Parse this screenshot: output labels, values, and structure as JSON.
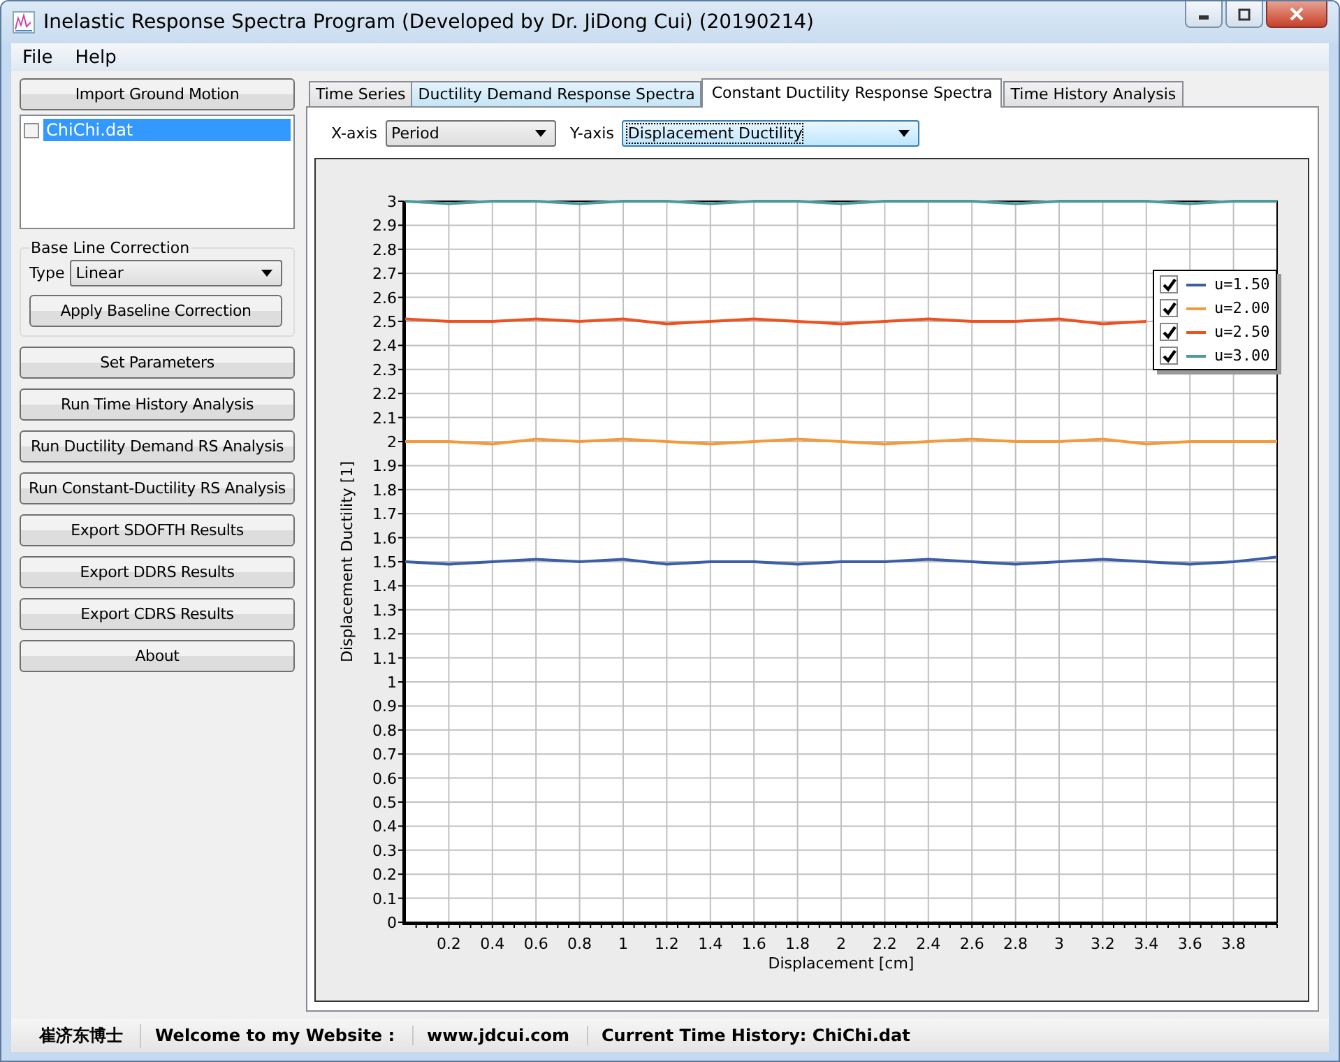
{
  "window": {
    "title": "Inelastic Response Spectra Program (Developed by Dr. JiDong Cui) (20190214)"
  },
  "menu": [
    "File",
    "Help"
  ],
  "sidebar": {
    "import_button": "Import Ground Motion",
    "files": [
      {
        "label": "ChiChi.dat",
        "checked": false,
        "selected": true
      }
    ],
    "baseline": {
      "title": "Base Line Correction",
      "type_label": "Type",
      "type_value": "Linear",
      "apply_button": "Apply Baseline Correction"
    },
    "buttons": [
      "Set Parameters",
      "Run Time History Analysis",
      "Run Ductility Demand RS Analysis",
      "Run Constant-Ductility RS Analysis",
      "Export SDOFTH Results",
      "Export DDRS Results",
      "Export CDRS Results",
      "About"
    ]
  },
  "tabs": [
    {
      "label": "Time Series",
      "selected": false
    },
    {
      "label": "Ductility Demand Response Spectra",
      "selected": false
    },
    {
      "label": "Constant Ductility Response Spectra",
      "selected": true
    },
    {
      "label": "Time History Analysis",
      "selected": false
    }
  ],
  "axis_selectors": [
    {
      "label": "X-axis",
      "value": "Period",
      "focused": false
    },
    {
      "label": "Y-axis",
      "value": "Displacement Ductility",
      "focused": true
    }
  ],
  "chart": {
    "legend": [
      {
        "checked": true
      },
      {
        "checked": true
      },
      {
        "checked": true
      },
      {
        "checked": true
      }
    ],
    "chart_data": {
      "type": "line",
      "xlabel": "Displacement [cm]",
      "ylabel": "Displacement Ductility [1]",
      "x": [
        0,
        0.2,
        0.4,
        0.6,
        0.8,
        1,
        1.2,
        1.4,
        1.6,
        1.8,
        2,
        2.2,
        2.4,
        2.6,
        2.8,
        3,
        3.2,
        3.4,
        3.6,
        3.8,
        4
      ],
      "series": [
        {
          "name": "u=1.50",
          "color": "#3c5ea8",
          "values": [
            1.5,
            1.49,
            1.5,
            1.51,
            1.5,
            1.51,
            1.49,
            1.5,
            1.5,
            1.49,
            1.5,
            1.5,
            1.51,
            1.5,
            1.49,
            1.5,
            1.51,
            1.5,
            1.49,
            1.5,
            1.52
          ]
        },
        {
          "name": "u=2.00",
          "color": "#f59a3c",
          "values": [
            2.0,
            2.0,
            1.99,
            2.01,
            2.0,
            2.01,
            2.0,
            1.99,
            2.0,
            2.01,
            2.0,
            1.99,
            2.0,
            2.01,
            2.0,
            2.0,
            2.01,
            1.99,
            2.0,
            2.0,
            2.0
          ]
        },
        {
          "name": "u=2.50",
          "color": "#f0501e",
          "values": [
            2.51,
            2.5,
            2.5,
            2.51,
            2.5,
            2.51,
            2.49,
            2.5,
            2.51,
            2.5,
            2.49,
            2.5,
            2.51,
            2.5,
            2.5,
            2.51,
            2.49,
            2.5,
            null,
            null,
            null
          ]
        },
        {
          "name": "u=3.00",
          "color": "#4a9a9e",
          "values": [
            3.0,
            2.99,
            3.0,
            3.0,
            2.99,
            3.0,
            3.0,
            2.99,
            3.0,
            3.0,
            2.99,
            3.0,
            3.0,
            3.0,
            2.99,
            3.0,
            3.0,
            3.0,
            2.99,
            3.0,
            3.0
          ]
        }
      ],
      "grid": true,
      "legend": "upper right",
      "xlim": [
        0,
        4
      ],
      "ylim": [
        0,
        3
      ],
      "xticks": [
        0.2,
        0.4,
        0.6,
        0.8,
        1,
        1.2,
        1.4,
        1.6,
        1.8,
        2,
        2.2,
        2.4,
        2.6,
        2.8,
        3,
        3.2,
        3.4,
        3.6,
        3.8
      ],
      "yticks": [
        0,
        0.1,
        0.2,
        0.3,
        0.4,
        0.5,
        0.6,
        0.7,
        0.8,
        0.9,
        1,
        1.1,
        1.2,
        1.3,
        1.4,
        1.5,
        1.6,
        1.7,
        1.8,
        1.9,
        2,
        2.1,
        2.2,
        2.3,
        2.4,
        2.5,
        2.6,
        2.7,
        2.8,
        2.9,
        3
      ]
    }
  },
  "status_bar": [
    "崔济东博士",
    "Welcome to my Website :",
    "www.jdcui.com",
    "Current Time History: ChiChi.dat"
  ]
}
